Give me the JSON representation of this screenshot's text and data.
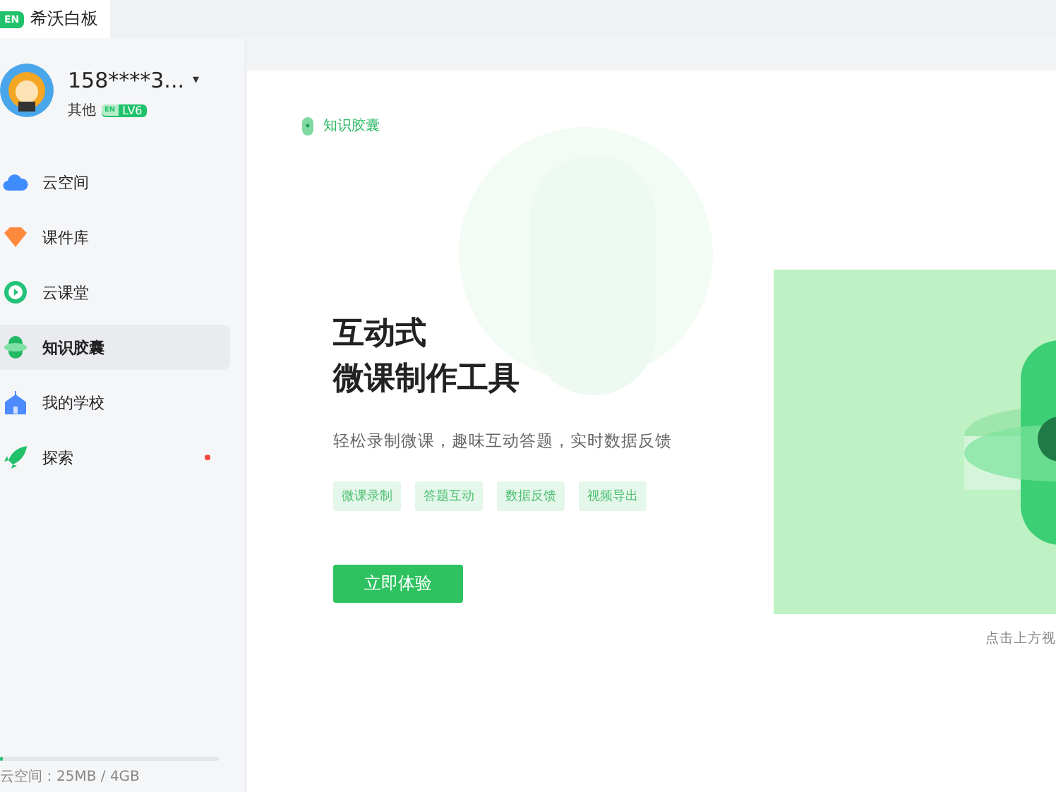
{
  "window": {
    "logo": "EN",
    "title": "希沃白板"
  },
  "user": {
    "name": "158****3...",
    "caret": "▾",
    "role": "其他",
    "badge_logo": "EN",
    "level_badge": "LV6"
  },
  "sidebar": {
    "items": [
      {
        "label": "云空间",
        "selected": false,
        "dot": false
      },
      {
        "label": "课件库",
        "selected": false,
        "dot": false
      },
      {
        "label": "云课堂",
        "selected": false,
        "dot": false
      },
      {
        "label": "知识胶囊",
        "selected": true,
        "dot": false
      },
      {
        "label": "我的学校",
        "selected": false,
        "dot": false
      },
      {
        "label": "探索",
        "selected": false,
        "dot": true
      }
    ]
  },
  "storage": {
    "level": 0.01,
    "label": "云空间：25MB / 4GB"
  },
  "hero": {
    "section": "知识胶囊",
    "title_lines": [
      "互动式",
      "微课制作工具"
    ],
    "subtitle": "轻松录制微课，趣味互动答题，实时数据反馈",
    "tags": [
      "微课录制",
      "答题互动",
      "数据反馈",
      "视频导出"
    ],
    "button": "立即体验",
    "caption": "点击上方视"
  }
}
